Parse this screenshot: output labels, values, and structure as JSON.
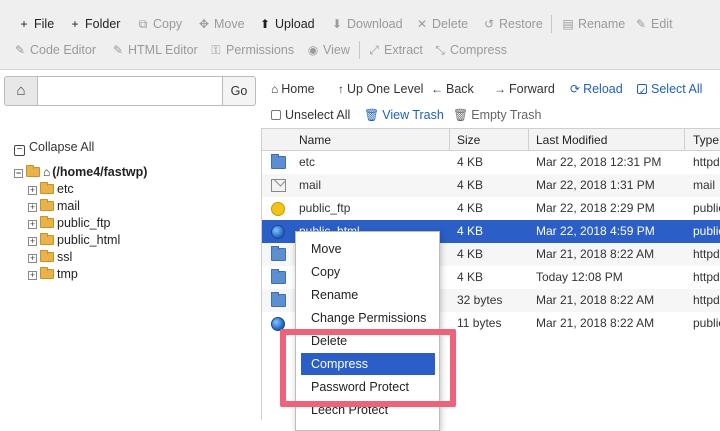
{
  "toolbar": {
    "row1": [
      {
        "key": "file",
        "icon": "+",
        "label": "File",
        "enabled": true
      },
      {
        "key": "folder",
        "icon": "+",
        "label": "Folder",
        "enabled": true
      },
      {
        "key": "copy",
        "icon": "⧉",
        "label": "Copy",
        "enabled": false
      },
      {
        "key": "move",
        "icon": "✥",
        "label": "Move",
        "enabled": false
      },
      {
        "key": "upload",
        "icon": "⬆",
        "label": "Upload",
        "enabled": true
      },
      {
        "key": "download",
        "icon": "⬇",
        "label": "Download",
        "enabled": false
      },
      {
        "key": "delete",
        "icon": "✕",
        "label": "Delete",
        "enabled": false
      },
      {
        "key": "restore",
        "icon": "↺",
        "label": "Restore",
        "enabled": false
      },
      {
        "key": "rename",
        "icon": "▤",
        "label": "Rename",
        "enabled": false
      },
      {
        "key": "edit",
        "icon": "✎",
        "label": "Edit",
        "enabled": false
      }
    ],
    "row2": [
      {
        "key": "code-editor",
        "icon": "✎",
        "label": "Code Editor",
        "enabled": false
      },
      {
        "key": "html-editor",
        "icon": "✎",
        "label": "HTML Editor",
        "enabled": false
      },
      {
        "key": "permissions",
        "icon": "⚿",
        "label": "Permissions",
        "enabled": false
      },
      {
        "key": "view",
        "icon": "◉",
        "label": "View",
        "enabled": false
      },
      {
        "key": "extract",
        "icon": "⤢",
        "label": "Extract",
        "enabled": false
      },
      {
        "key": "compress",
        "icon": "⤡",
        "label": "Compress",
        "enabled": false
      }
    ]
  },
  "left": {
    "path_value": "",
    "go_label": "Go",
    "collapse_all_label": "Collapse All",
    "tree_root_label": "(/home4/fastwp)",
    "tree_items": [
      "etc",
      "mail",
      "public_ftp",
      "public_html",
      "ssl",
      "tmp"
    ]
  },
  "nav": {
    "home": "Home",
    "up_one_level": "Up One Level",
    "back": "Back",
    "forward": "Forward",
    "reload": "Reload",
    "select_all": "Select All",
    "unselect_all": "Unselect All",
    "view_trash": "View Trash",
    "empty_trash": "Empty Trash"
  },
  "table": {
    "headers": {
      "name": "Name",
      "size": "Size",
      "last_modified": "Last Modified",
      "type": "Type"
    },
    "rows": [
      {
        "icon": "folder",
        "name": "etc",
        "size": "4 KB",
        "modified": "Mar 22, 2018 12:31 PM",
        "type": "httpd/"
      },
      {
        "icon": "mail",
        "name": "mail",
        "size": "4 KB",
        "modified": "Mar 22, 2018 1:31 PM",
        "type": "mail"
      },
      {
        "icon": "ftp",
        "name": "public_ftp",
        "size": "4 KB",
        "modified": "Mar 22, 2018 2:29 PM",
        "type": "public"
      },
      {
        "icon": "globe",
        "name": "public_html",
        "size": "4 KB",
        "modified": "Mar 22, 2018 4:59 PM",
        "type": "public",
        "selected": true
      },
      {
        "icon": "folder",
        "name": "",
        "size": "4 KB",
        "modified": "Mar 21, 2018 8:22 AM",
        "type": "httpd/"
      },
      {
        "icon": "folder",
        "name": "",
        "size": "4 KB",
        "modified": "Today 12:08 PM",
        "type": "httpd/"
      },
      {
        "icon": "folder",
        "name": "",
        "size": "32 bytes",
        "modified": "Mar 21, 2018 8:22 AM",
        "type": "httpd/"
      },
      {
        "icon": "globe",
        "name": "",
        "size": "11 bytes",
        "modified": "Mar 21, 2018 8:22 AM",
        "type": "public"
      }
    ]
  },
  "context_menu": {
    "items": [
      "Move",
      "Copy",
      "Rename",
      "Change Permissions",
      "Delete",
      "Compress",
      "Password Protect",
      "Leech Protect"
    ],
    "active_item": "Compress"
  },
  "colors": {
    "selection": "#2b5fc7",
    "link": "#1f5fbf",
    "highlight_box": "#f0617a",
    "toolbar_bg": "#efefef"
  }
}
